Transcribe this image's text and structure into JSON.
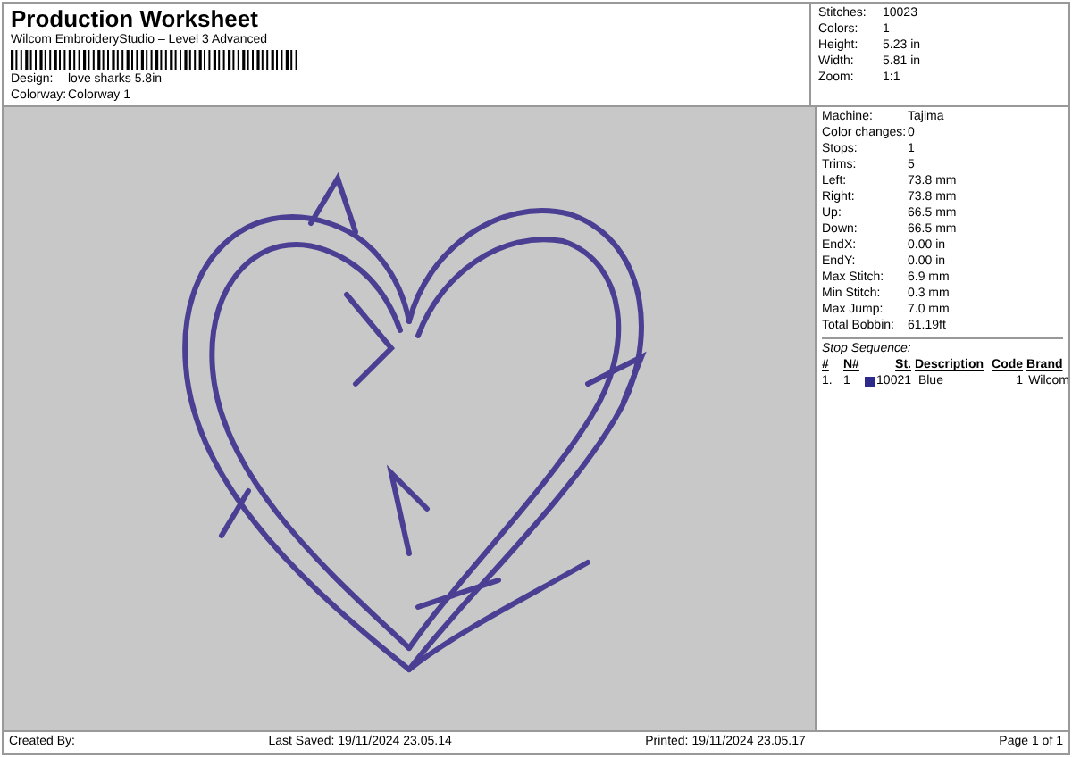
{
  "header": {
    "title": "Production Worksheet",
    "subtitle": "Wilcom EmbroideryStudio – Level 3 Advanced",
    "fields": [
      {
        "label": "Design:",
        "value": "love sharks 5.8in"
      },
      {
        "label": "Colorway:",
        "value": "Colorway 1"
      }
    ]
  },
  "summary": [
    {
      "label": "Stitches:",
      "value": "10023"
    },
    {
      "label": "Colors:",
      "value": "1"
    },
    {
      "label": "Height:",
      "value": "5.23 in"
    },
    {
      "label": "Width:",
      "value": "5.81 in"
    },
    {
      "label": "Zoom:",
      "value": "1:1"
    }
  ],
  "details": [
    {
      "label": "Machine:",
      "value": "Tajima"
    },
    {
      "label": "Color changes:",
      "value": "0"
    },
    {
      "label": "Stops:",
      "value": "1"
    },
    {
      "label": "Trims:",
      "value": "5"
    },
    {
      "label": "Left:",
      "value": "73.8 mm"
    },
    {
      "label": "Right:",
      "value": "73.8 mm"
    },
    {
      "label": "Up:",
      "value": "66.5 mm"
    },
    {
      "label": "Down:",
      "value": "66.5 mm"
    },
    {
      "label": "EndX:",
      "value": "0.00 in"
    },
    {
      "label": "EndY:",
      "value": "0.00 in"
    },
    {
      "label": "Max Stitch:",
      "value": "6.9 mm"
    },
    {
      "label": "Min Stitch:",
      "value": "0.3 mm"
    },
    {
      "label": "Max Jump:",
      "value": "7.0 mm"
    },
    {
      "label": "Total Bobbin:",
      "value": "61.19ft"
    }
  ],
  "stop_sequence": {
    "title": "Stop Sequence:",
    "columns": [
      "#",
      "N#",
      "St.",
      "Description",
      "Code",
      "Brand"
    ],
    "rows": [
      {
        "index": "1.",
        "needle": "1",
        "color": "#2e2a8c",
        "stitches": "10021",
        "description": "Blue",
        "code": "1",
        "brand": "Wilcom"
      }
    ]
  },
  "footer": {
    "created": "Created By:",
    "saved": "Last Saved: 19/11/2024 23.05.14",
    "printed": "Printed: 19/11/2024 23.05.17",
    "page": "Page 1 of 1"
  }
}
